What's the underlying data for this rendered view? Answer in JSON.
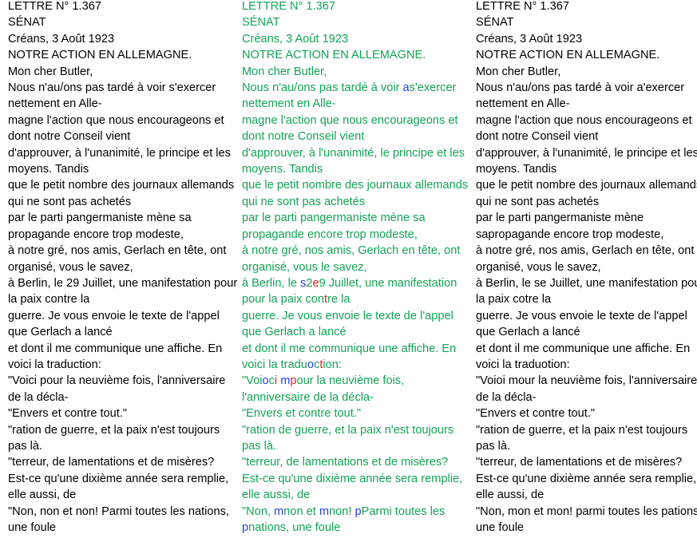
{
  "colors": {
    "match": "#13a355",
    "deleted": "#e0241e",
    "inserted": "#2a3ce0",
    "text": "#000000"
  },
  "columns": [
    {
      "lines": [
        [
          {
            "t": "LETTRE N° 1.367"
          }
        ],
        [
          {
            "t": "SÉNAT"
          }
        ],
        [
          {
            "t": "Créans, 3 Août 1923"
          }
        ],
        [
          {
            "t": "NOTRE ACTION EN ALLEMAGNE."
          }
        ],
        [
          {
            "t": "Mon cher Butler,"
          }
        ],
        [
          {
            "t": "Nous n'au/ons pas tardé à voir s'exercer"
          }
        ],
        [
          {
            "t": "nettement en Alle-"
          }
        ],
        [
          {
            "t": "magne l'action que nous encourageons et"
          }
        ],
        [
          {
            "t": "dont notre Conseil vient"
          }
        ],
        [
          {
            "t": "d'approuver, à l'unanimité, le principe et les"
          }
        ],
        [
          {
            "t": "moyens. Tandis"
          }
        ],
        [
          {
            "t": "que le petit nombre des journaux allemands"
          }
        ],
        [
          {
            "t": "qui ne sont pas achetés"
          }
        ],
        [
          {
            "t": "par le parti pangermaniste mène sa"
          }
        ],
        [
          {
            "t": "propagande encore trop modeste,"
          }
        ],
        [
          {
            "t": "à notre gré, nos amis, Gerlach en tête, ont"
          }
        ],
        [
          {
            "t": "organisé, vous le savez,"
          }
        ],
        [
          {
            "t": "à Berlin, le 29 Juillet, une manifestation pour"
          }
        ],
        [
          {
            "t": "la paix contre la"
          }
        ],
        [
          {
            "t": "guerre. Je vous envoie le texte de l'appel"
          }
        ],
        [
          {
            "t": "que Gerlach a lancé"
          }
        ],
        [
          {
            "t": "et dont il me communique une affiche. En"
          }
        ],
        [
          {
            "t": "voici la traduction:"
          }
        ],
        [
          {
            "t": "\"Voici pour la neuvième fois, l'anniversaire"
          }
        ],
        [
          {
            "t": "de la décla-"
          }
        ],
        [
          {
            "t": "\"Envers et contre tout.\""
          }
        ],
        [
          {
            "t": "\"ration de guerre, et la paix n'est toujours"
          }
        ],
        [
          {
            "t": "pas là."
          }
        ],
        [
          {
            "t": "\"terreur, de lamentations et de misères?"
          }
        ],
        [
          {
            "t": "Est-ce qu'une dixième année sera remplie,"
          }
        ],
        [
          {
            "t": "elle aussi, de"
          }
        ],
        [
          {
            "t": "\"Non, non et non! Parmi toutes les nations,"
          }
        ],
        [
          {
            "t": "une foule"
          }
        ]
      ]
    },
    {
      "lines": [
        [
          {
            "t": "LETTRE N° 1.367"
          }
        ],
        [
          {
            "t": "SÉNAT"
          }
        ],
        [
          {
            "t": "Créans, 3 Août 1923"
          }
        ],
        [
          {
            "t": "NOTRE ACTION EN ALLEMAGNE."
          }
        ],
        [
          {
            "t": "Mon cher Butler,"
          }
        ],
        [
          {
            "t": "Nous n'au/ons pas tardé à voir "
          },
          {
            "t": "a",
            "c": "ins"
          },
          {
            "t": "s'exercer"
          }
        ],
        [
          {
            "t": "nettement en Alle-"
          }
        ],
        [
          {
            "t": "magne l'action que nous encourageons et"
          }
        ],
        [
          {
            "t": "dont notre Conseil vient"
          }
        ],
        [
          {
            "t": "d'approuver, à l'unanimité, le principe et les"
          }
        ],
        [
          {
            "t": "moyens. Tandis"
          }
        ],
        [
          {
            "t": "que le petit nombre des journaux allemands"
          }
        ],
        [
          {
            "t": "qui ne sont pas achetés"
          }
        ],
        [
          {
            "t": "par le parti pangermaniste mène sa"
          }
        ],
        [
          {
            "t": "propagande encore trop modeste,"
          }
        ],
        [
          {
            "t": "à notre gré, nos amis, Gerlach en tête, ont"
          }
        ],
        [
          {
            "t": "organisé, vous le savez,"
          }
        ],
        [
          {
            "t": "à Berlin, le "
          },
          {
            "t": "s",
            "c": "ins"
          },
          {
            "t": "2"
          },
          {
            "t": "e",
            "c": "del"
          },
          {
            "t": "9"
          },
          {
            "t": " Juillet, une manifestation"
          }
        ],
        [
          {
            "t": "pour la paix con"
          },
          {
            "t": "t",
            "c": "del"
          },
          {
            "t": "re la"
          }
        ],
        [
          {
            "t": "guerre. Je vous envoie le texte de l'appel"
          }
        ],
        [
          {
            "t": "que Gerlach a lancé"
          }
        ],
        [
          {
            "t": "et dont il me communique une affiche. En"
          }
        ],
        [
          {
            "t": "voici la tradu"
          },
          {
            "t": "o",
            "c": "ins"
          },
          {
            "t": "c"
          },
          {
            "t": "t",
            "c": "del"
          },
          {
            "t": "ion:"
          }
        ],
        [
          {
            "t": "\"Voi"
          },
          {
            "t": "o",
            "c": "ins"
          },
          {
            "t": "c"
          },
          {
            "t": "i",
            "c": "del"
          },
          {
            "t": " "
          },
          {
            "t": "m",
            "c": "ins"
          },
          {
            "t": "p",
            "c": "del"
          },
          {
            "t": "our la neuvième fois,"
          }
        ],
        [
          {
            "t": "l'anniversaire de la décla-"
          }
        ],
        [
          {
            "t": "\"Envers et contre tout.\""
          }
        ],
        [
          {
            "t": "\"ration de guerre, et la paix n'est toujours"
          }
        ],
        [
          {
            "t": "pas là."
          }
        ],
        [
          {
            "t": "\"terreur, de lamentations et de misères?"
          }
        ],
        [
          {
            "t": "Est-ce qu'une dixième année sera remplie,"
          }
        ],
        [
          {
            "t": "elle aussi, de"
          }
        ],
        [
          {
            "t": "\"Non, "
          },
          {
            "t": "m",
            "c": "ins"
          },
          {
            "t": "n"
          },
          {
            "t": "on et "
          },
          {
            "t": "m",
            "c": "ins"
          },
          {
            "t": "non! "
          },
          {
            "t": "p",
            "c": "ins"
          },
          {
            "t": "P"
          },
          {
            "t": "armi toutes les"
          }
        ],
        [
          {
            "t": "p",
            "c": "ins"
          },
          {
            "t": "nations, une foule"
          }
        ]
      ]
    },
    {
      "lines": [
        [
          {
            "t": "LETTRE N° 1.367"
          }
        ],
        [
          {
            "t": "SÉNAT"
          }
        ],
        [
          {
            "t": "Créans, 3 Août 1923"
          }
        ],
        [
          {
            "t": "NOTRE ACTION EN ALLEMAGNE."
          }
        ],
        [
          {
            "t": "Mon cher Butler,"
          }
        ],
        [
          {
            "t": "Nous n'au/ons pas tardé à voir a'exercer"
          }
        ],
        [
          {
            "t": "nettement en Alle-"
          }
        ],
        [
          {
            "t": "magne l'action que nous encourageons et"
          }
        ],
        [
          {
            "t": "dont notre Conseil vient"
          }
        ],
        [
          {
            "t": "d'approuver, à l'unanimité, le principe et les"
          }
        ],
        [
          {
            "t": "moyens. Tandis"
          }
        ],
        [
          {
            "t": "que le petit nombre des journaux allemands"
          }
        ],
        [
          {
            "t": "qui ne sont pas achetés"
          }
        ],
        [
          {
            "t": "par le parti pangermaniste mène"
          }
        ],
        [
          {
            "t": "sapropagande encore trop modeste,"
          }
        ],
        [
          {
            "t": "à notre gré, nos amis, Gerlach en tête, ont"
          }
        ],
        [
          {
            "t": "organisé, vous le savez,"
          }
        ],
        [
          {
            "t": "à Berlin, le se Juillet, une manifestation pour"
          }
        ],
        [
          {
            "t": "la paix cotre la"
          }
        ],
        [
          {
            "t": "guerre. Je vous envoie le texte de l'appel"
          }
        ],
        [
          {
            "t": "que Gerlach a lancé"
          }
        ],
        [
          {
            "t": "et dont il me communique une affiche. En"
          }
        ],
        [
          {
            "t": "voici la traduotion:"
          }
        ],
        [
          {
            "t": "\"Voioi mour la neuvième fois, l'anniversaire"
          }
        ],
        [
          {
            "t": "de la décla-"
          }
        ],
        [
          {
            "t": "\"Envers et contre tout.\""
          }
        ],
        [
          {
            "t": "\"ration de guerre, et la paix n'est toujours"
          }
        ],
        [
          {
            "t": "pas là."
          }
        ],
        [
          {
            "t": "\"terreur, de lamentations et de misères?"
          }
        ],
        [
          {
            "t": "Est-ce qu'une dixième année sera remplie,"
          }
        ],
        [
          {
            "t": "elle aussi, de"
          }
        ],
        [
          {
            "t": "\"Non, mon et mon! parmi toutes les pations,"
          }
        ],
        [
          {
            "t": "une foule"
          }
        ]
      ]
    }
  ]
}
